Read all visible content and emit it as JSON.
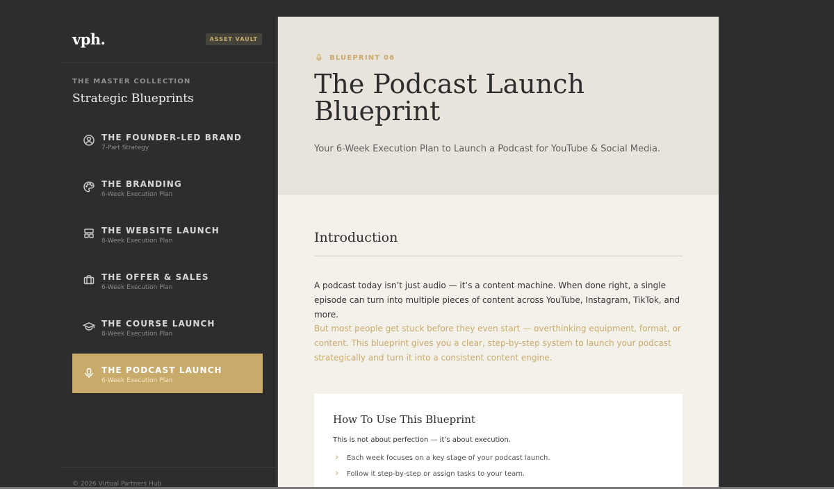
{
  "sidebar": {
    "logo": "vph.",
    "badge": "ASSET VAULT",
    "collection_eyebrow": "THE MASTER COLLECTION",
    "collection_title": "Strategic Blueprints",
    "items": [
      {
        "title": "THE FOUNDER-LED BRAND",
        "subtitle": "7-Part Strategy",
        "icon": "user-circle-icon"
      },
      {
        "title": "THE BRANDING",
        "subtitle": "6-Week Execution Plan",
        "icon": "palette-icon"
      },
      {
        "title": "THE WEBSITE LAUNCH",
        "subtitle": "8-Week Execution Plan",
        "icon": "layout-icon"
      },
      {
        "title": "THE OFFER & SALES",
        "subtitle": "6-Week Execution Plan",
        "icon": "briefcase-icon"
      },
      {
        "title": "THE COURSE LAUNCH",
        "subtitle": "8-Week Execution Plan",
        "icon": "graduation-cap-icon"
      },
      {
        "title": "THE PODCAST LAUNCH",
        "subtitle": "6-Week Execution Plan",
        "icon": "microphone-icon"
      }
    ],
    "copyright": "© 2026 Virtual Partners Hub"
  },
  "main": {
    "eyebrow": "BLUEPRINT 06",
    "title": "The Podcast Launch Blueprint",
    "subtitle": "Your 6-Week Execution Plan to Launch a Podcast for YouTube & Social Media.",
    "intro_heading": "Introduction",
    "intro_paragraph_1": "A podcast today isn’t just audio — it’s a content machine. When done right, a single episode can turn into multiple pieces of content across YouTube, Instagram, TikTok, and more.",
    "intro_paragraph_2": "But most people get stuck before they even start — overthinking equipment, format, or content. This blueprint gives you a clear, step-by-step system to launch your podcast strategically and turn it into a consistent content engine.",
    "howto_title": "How To Use This Blueprint",
    "howto_lead": "This is not about perfection — it’s about execution.",
    "howto_items": [
      "Each week focuses on a key stage of your podcast launch.",
      "Follow it step-by-step or assign tasks to your team."
    ]
  },
  "colors": {
    "accent": "#c8aa6b",
    "sidebar_bg": "#2d2d2d",
    "hero_bg": "#e8e4dc",
    "content_bg": "#f4f1eb",
    "text_dark": "#2d2d2d"
  }
}
